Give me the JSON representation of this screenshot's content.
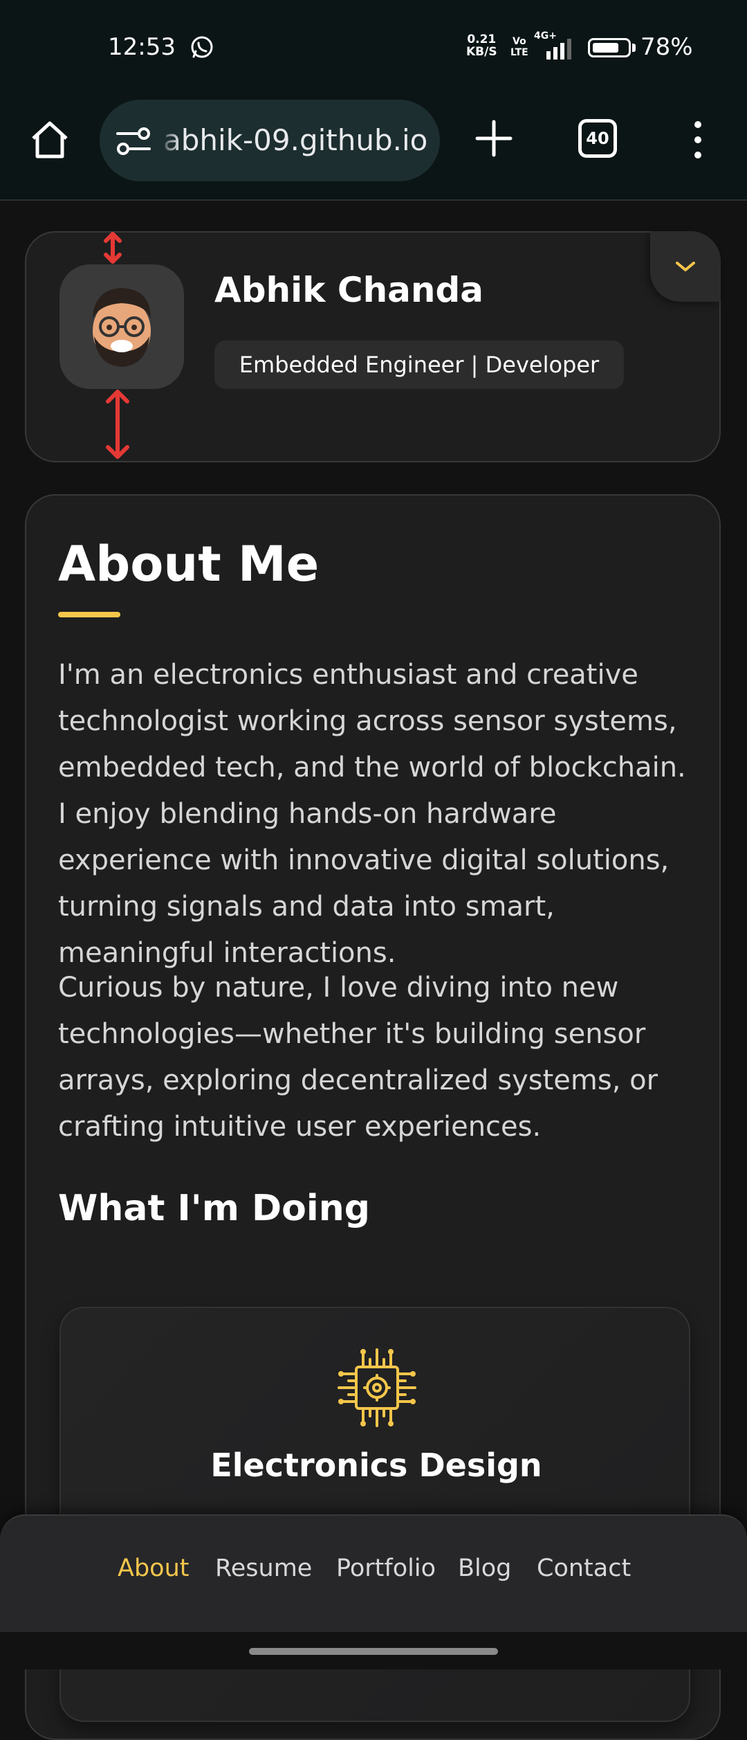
{
  "status_bar": {
    "time": "12:53",
    "net_speed_value": "0.21",
    "net_speed_unit": "KB/S",
    "volte_top": "Vo",
    "volte_bottom": "LTE",
    "network_type": "4G+",
    "battery_percent": "78%",
    "battery_level": 0.78
  },
  "browser": {
    "url": "abhik-09.github.io",
    "tab_count": "40"
  },
  "profile": {
    "name": "Abhik Chanda",
    "title": "Embedded Engineer | Developer"
  },
  "about": {
    "heading": "About Me",
    "paragraph_1": "I'm an electronics enthusiast and creative technologist working across sensor systems, embedded tech, and the world of blockchain. I enjoy blending hands-on hardware experience with innovative digital solutions, turning signals and data into smart, meaningful interactions.",
    "paragraph_2": "Curious by nature, I love diving into new technologies—whether it's building sensor arrays, exploring decentralized systems, or crafting intuitive user experiences.",
    "doing_heading": "What I'm Doing",
    "services": [
      {
        "title": "Electronics Design",
        "icon": "circuit-chip-icon"
      }
    ]
  },
  "nav": {
    "items": [
      {
        "label": "About",
        "active": true
      },
      {
        "label": "Resume",
        "active": false
      },
      {
        "label": "Portfolio",
        "active": false
      },
      {
        "label": "Blog",
        "active": false
      },
      {
        "label": "Contact",
        "active": false
      }
    ]
  },
  "colors": {
    "accent": "#f5c64b",
    "annotation_arrow": "#e53935",
    "card_bg": "#1e1e1f",
    "page_bg": "#121212"
  }
}
